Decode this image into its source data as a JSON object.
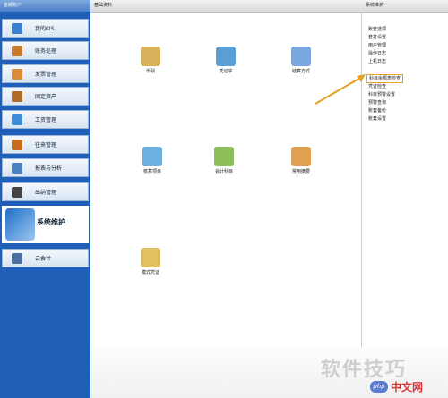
{
  "sidebar": {
    "header": "金蝶账户",
    "items": [
      {
        "label": "我的KIS",
        "color": "#3a7fd0"
      },
      {
        "label": "账务处理",
        "color": "#c77a2a"
      },
      {
        "label": "发票管理",
        "color": "#d98a3a"
      },
      {
        "label": "固定资产",
        "color": "#b06b2a"
      },
      {
        "label": "工资管理",
        "color": "#3e8bd6"
      },
      {
        "label": "往来管理",
        "color": "#c46d20"
      },
      {
        "label": "报表与分析",
        "color": "#4a7fc0"
      },
      {
        "label": "出纳管理",
        "color": "#444444"
      },
      {
        "label": "系统维护",
        "color": "#1f6fc8"
      },
      {
        "label": "云会计",
        "color": "#4a6fa0"
      }
    ]
  },
  "top_bar": {
    "left_title": "基础资料",
    "right_title": "系统维护"
  },
  "modules": [
    {
      "label": "币别",
      "color": "#d7b05a"
    },
    {
      "label": "凭证字",
      "color": "#5a9fd6"
    },
    {
      "label": "结算方式",
      "color": "#7aa7e0"
    },
    {
      "label": "核算项目",
      "color": "#6ab0e0"
    },
    {
      "label": "会计科目",
      "color": "#8fbf5a"
    },
    {
      "label": "常用摘要",
      "color": "#e0a050"
    },
    {
      "label": "模式凭证",
      "color": "#e0c060"
    }
  ],
  "right_list": [
    "账套选项",
    "套打设置",
    "用户管理",
    "操作日志",
    "上机日志",
    "科目余额表检查",
    "凭证检查",
    "科目预警设置",
    "预警查询",
    "账套备份",
    "账套设置"
  ],
  "highlighted_item": "科目余额表检查",
  "watermark": "软件技巧",
  "brand": {
    "php": "php",
    "site": "中文网"
  },
  "colors": {
    "sidebar_bg": "#1f5fb8",
    "highlight": "#e8a020"
  }
}
